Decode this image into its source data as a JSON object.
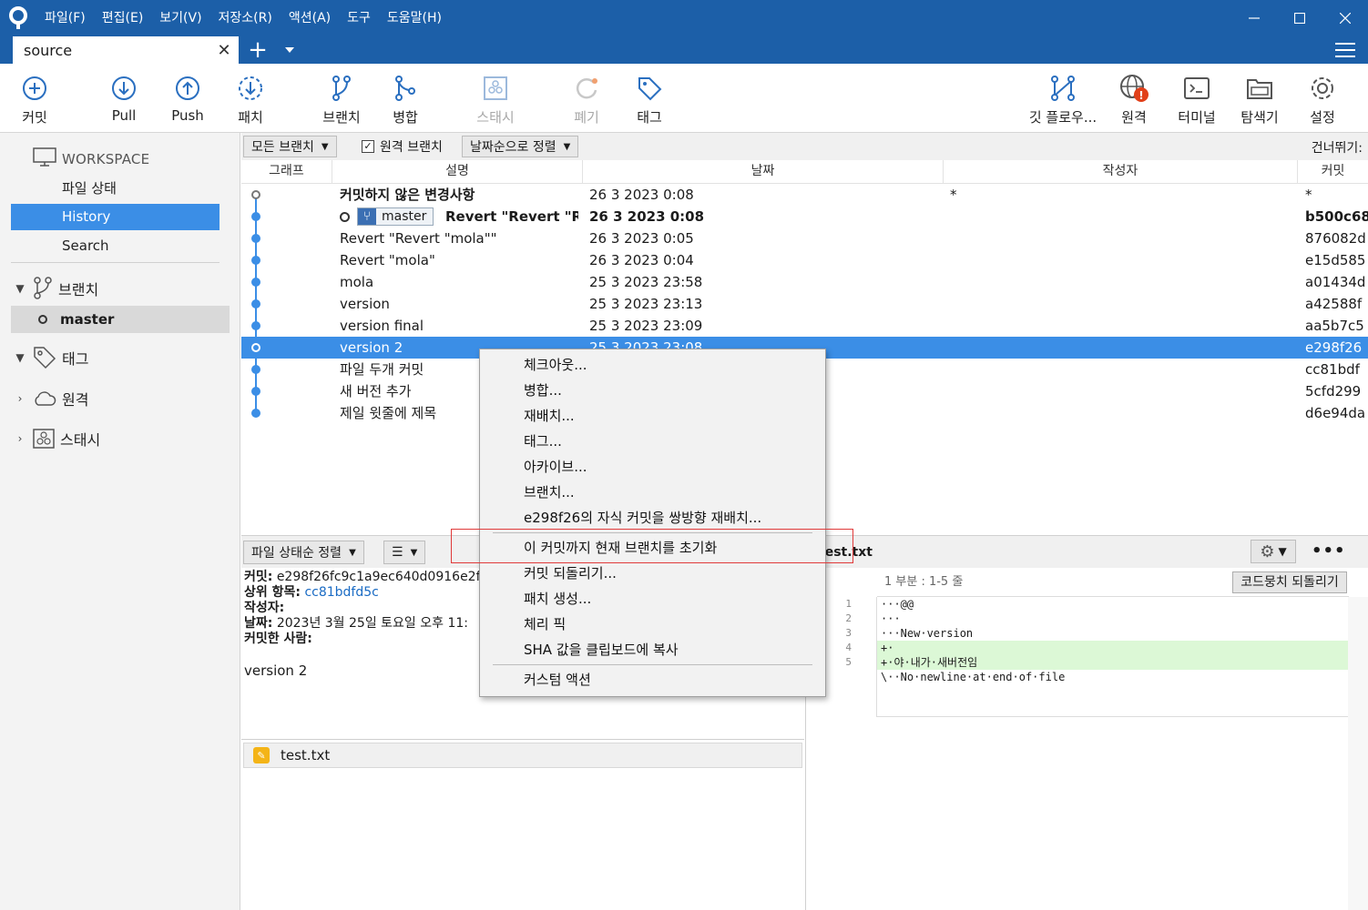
{
  "menu": [
    "파일(F)",
    "편집(E)",
    "보기(V)",
    "저장소(R)",
    "액션(A)",
    "도구",
    "도움말(H)"
  ],
  "tab": {
    "title": "source"
  },
  "toolbar": {
    "commit": "커밋",
    "pull": "Pull",
    "push": "Push",
    "patch": "패치",
    "branch": "브랜치",
    "merge": "병합",
    "stash": "스태시",
    "discard": "폐기",
    "tag": "태그",
    "gitflow": "깃 플로우...",
    "remote": "원격",
    "terminal": "터미널",
    "explorer": "탐색기",
    "settings": "설정"
  },
  "sidebar": {
    "workspace": "WORKSPACE",
    "links": [
      "파일 상태",
      "History",
      "Search"
    ],
    "branches_label": "브랜치",
    "branch_name": "master",
    "tags_label": "태그",
    "remotes_label": "원격",
    "stashes_label": "스태시"
  },
  "filter": {
    "branches": "모든 브랜치",
    "remote_branches": "원격 브랜치",
    "sort": "날짜순으로 정렬",
    "jump": "건너뛰기:"
  },
  "columns": {
    "graph": "그래프",
    "desc": "설명",
    "date": "날짜",
    "author": "작성자",
    "commit": "커밋"
  },
  "commits": [
    {
      "desc": "커밋하지 않은 변경사항",
      "date": "26 3 2023 0:08",
      "author": "*",
      "hash": "*"
    },
    {
      "desc": "Revert \"Revert \"Revert \"mola\"\"\"",
      "date": "26 3 2023 0:08",
      "author": "",
      "hash": "b500c68",
      "branch": "master"
    },
    {
      "desc": "Revert \"Revert \"mola\"\"",
      "date": "26 3 2023 0:05",
      "author": "",
      "hash": "876082d"
    },
    {
      "desc": "Revert \"mola\"",
      "date": "26 3 2023 0:04",
      "author": "",
      "hash": "e15d585"
    },
    {
      "desc": "mola",
      "date": "25 3 2023 23:58",
      "author": "",
      "hash": "a01434d"
    },
    {
      "desc": "version",
      "date": "25 3 2023 23:13",
      "author": "",
      "hash": "a42588f"
    },
    {
      "desc": "version final",
      "date": "25 3 2023 23:09",
      "author": "",
      "hash": "aa5b7c5"
    },
    {
      "desc": "version 2",
      "date": "25 3 2023 23:08",
      "author": "",
      "hash": "e298f26"
    },
    {
      "desc": "파일 두개 커밋",
      "date": "",
      "author": "",
      "hash": "cc81bdf"
    },
    {
      "desc": "새 버전 추가",
      "date": "",
      "author": "",
      "hash": "5cfd299"
    },
    {
      "desc": "제일 윗줄에 제목",
      "date": "",
      "author": "",
      "hash": "d6e94da"
    }
  ],
  "lower_left": {
    "sort": "파일 상태순 정렬",
    "view": "☰",
    "commit_label": "커밋:",
    "commit_value": "e298f26fc9c1a9ec640d0916e2f",
    "parent_label": "상위 항목:",
    "parent_value": "cc81bdfd5c",
    "author_label": "작성자:",
    "date_label": "날짜:",
    "date_value": "2023년 3월 25일 토요일 오후 11:",
    "committer_label": "커밋한 사람:",
    "message": "version 2",
    "file": "test.txt"
  },
  "diff": {
    "file": "test.txt",
    "hunk": "1 부분 : 1-5 줄",
    "revert_hunk": "코드뭉치 되돌리기",
    "line_numbers": [
      "1",
      "2",
      "3",
      "4",
      "5"
    ],
    "lines": [
      "···@@",
      "···",
      "···New·version",
      "+·",
      "+·야·내가·새버전임",
      "\\··No·newline·at·end·of·file"
    ]
  },
  "context_menu": [
    "체크아웃...",
    "병합...",
    "재배치...",
    "태그...",
    "아카이브...",
    "브랜치...",
    "e298f26의 자식 커밋을 쌍방향 재배치...",
    "이 커밋까지 현재 브랜치를 초기화",
    "커밋 되돌리기...",
    "패치 생성...",
    "체리 픽",
    "SHA 값을 클립보드에 복사",
    "커스텀 액션"
  ],
  "colors": {
    "accent": "#1c5fa8",
    "selection": "#3b8ee6",
    "highlight": "#e03a3a",
    "added": "#dcf8d6"
  }
}
